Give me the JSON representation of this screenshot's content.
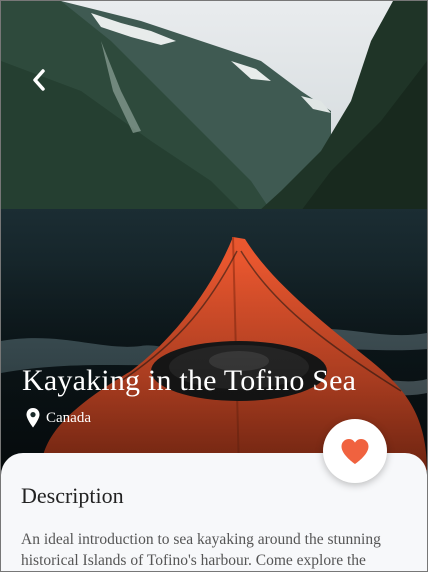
{
  "activity": {
    "title": "Kayaking in the Tofino Sea",
    "location": "Canada"
  },
  "description": {
    "heading": "Description",
    "body": "An ideal introduction to sea kayaking around the stunning historical Islands of Tofino's harbour. Come explore the"
  },
  "icons": {
    "back": "chevron-left-icon",
    "location": "map-pin-icon",
    "favorite": "heart-icon"
  },
  "colors": {
    "accent": "#f0623f",
    "card_background": "#f7f8fa"
  }
}
